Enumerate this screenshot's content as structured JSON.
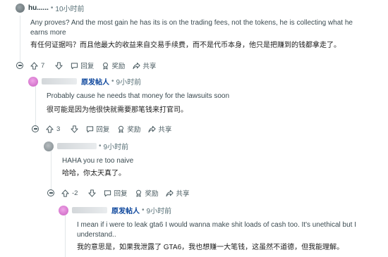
{
  "comments": [
    {
      "author": "hu......",
      "time": "10小时前",
      "body_en": "Any proves? And the most gain he has its is on the trading fees, not the tokens, he is collecting what he earns more",
      "body_cn": "有任何证据吗？而且他最大的收益来自交易手续费，而不是代币本身，他只是把赚到的钱都拿走了。",
      "votes": "7",
      "reply_label": "回复",
      "award_label": "奖励",
      "share_label": "共享"
    },
    {
      "author": "原发帖人",
      "time": "9小时前",
      "body_en": "Probably cause he needs that money for the lawsuits soon",
      "body_cn": "很可能是因为他很快就需要那笔钱来打官司。",
      "votes": "3",
      "reply_label": "回复",
      "award_label": "奖励",
      "share_label": "共享"
    },
    {
      "author": "",
      "time": "9小时前",
      "body_en": "HAHA you re too naive",
      "body_cn": "哈哈，你太天真了。",
      "votes": "-2",
      "reply_label": "回复",
      "award_label": "奖励",
      "share_label": "共享"
    },
    {
      "author": "原发帖人",
      "time": "9小时前",
      "body_en": "I mean if i were to leak gta6 I would wanna make shit loads of cash too. It's unethical but I understand..",
      "body_cn": "我的意思是，如果我泄露了 GTA6，我也想赚一大笔钱，这虽然不道德，但我能理解。"
    }
  ],
  "colors": {
    "accent_blue": "#0a449b",
    "muted": "#576f76",
    "thread_line": "#e2e7e9"
  }
}
